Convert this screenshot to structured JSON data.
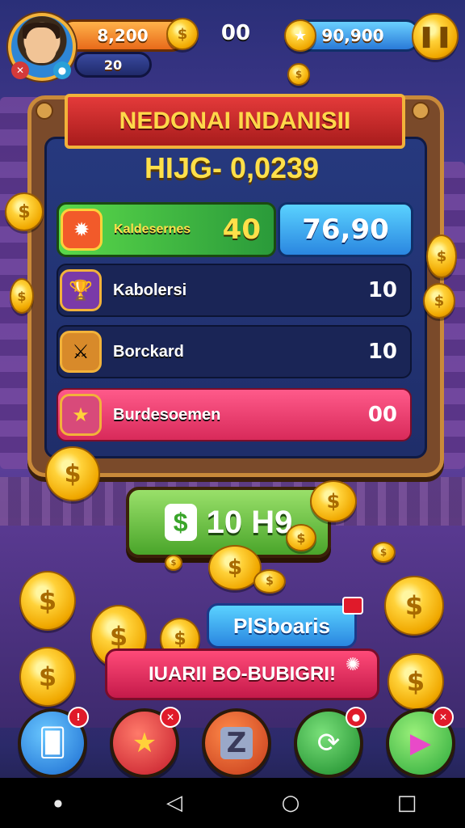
{
  "hud": {
    "coins": "8,200",
    "level": "20",
    "center_score": "00",
    "gems": "90,900",
    "pause_icon": "pause-icon"
  },
  "panel": {
    "title": "NEDONAI INDANISII",
    "high_score": "HIJG- 0,0239",
    "highlight_left": {
      "label": "Kaldesernes",
      "value": "40"
    },
    "highlight_right": {
      "value": "76,90"
    },
    "rows": [
      {
        "label": "Kabolersi",
        "value": "10",
        "icon": "trophy-icon"
      },
      {
        "label": "Borckard",
        "value": "10",
        "icon": "viking-icon"
      },
      {
        "label": "Burdesoemen",
        "value": "00",
        "icon": "badge-icon"
      }
    ]
  },
  "collect_button": {
    "label": "10 H9",
    "icon": "dollar-icon"
  },
  "promo": {
    "blue_label": "PlSboaris",
    "red_label": "IUARII BO-BUBIGRI!"
  },
  "action_buttons": [
    {
      "name": "cards",
      "icon": "card-icon",
      "color": "#2a8ce8"
    },
    {
      "name": "star",
      "icon": "star-icon",
      "color": "#e83a3a"
    },
    {
      "name": "z-box",
      "icon": "z-icon",
      "color": "#e05a2a"
    },
    {
      "name": "refresh",
      "icon": "refresh-icon",
      "color": "#3aa53a"
    },
    {
      "name": "play",
      "icon": "play-icon",
      "color": "#4ac84a"
    }
  ],
  "colors": {
    "gold": "#ffd23a",
    "panel_blue": "#26397e",
    "accent_red": "#e43a3a",
    "green": "#4aa52a"
  }
}
